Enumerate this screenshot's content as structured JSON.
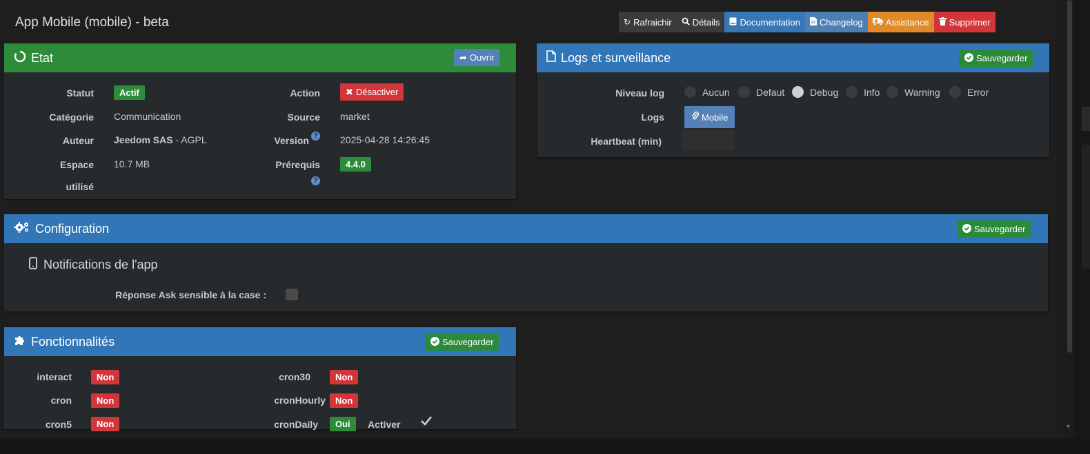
{
  "app": {
    "title": "App Mobile (mobile) - beta"
  },
  "toolbar": {
    "refresh": {
      "label": "Rafraichir",
      "icon": "refresh-icon"
    },
    "details": {
      "label": "Détails",
      "icon": "search-icon"
    },
    "documentation": {
      "label": "Documentation",
      "icon": "book-icon"
    },
    "changelog": {
      "label": "Changelog",
      "icon": "file-icon"
    },
    "assistance": {
      "label": "Assistance",
      "icon": "ambulance-icon"
    },
    "delete": {
      "label": "Supprimer",
      "icon": "trash-icon"
    }
  },
  "etat": {
    "title": "Etat",
    "open_button": "Ouvrir",
    "status_label": "Statut",
    "status_value": "Actif",
    "action_label": "Action",
    "action_button": "Désactiver",
    "category_label": "Catégorie",
    "category_value": "Communication",
    "source_label": "Source",
    "source_value": "market",
    "author_label": "Auteur",
    "author_value": "Jeedom SAS",
    "license_value": " - AGPL",
    "version_label": "Version",
    "version_value": "2025-04-28 14:26:45",
    "space_label_1": "Espace",
    "space_label_2": "utilisé",
    "space_value": "10.7 MB",
    "prereq_label": "Prérequis",
    "prereq_value": "4.4.0"
  },
  "logs": {
    "title": "Logs et surveillance",
    "save_button": "Sauvegarder",
    "level_label": "Niveau log",
    "levels": [
      {
        "label": "Aucun",
        "selected": false
      },
      {
        "label": "Defaut",
        "selected": false
      },
      {
        "label": "Debug",
        "selected": true
      },
      {
        "label": "Info",
        "selected": false
      },
      {
        "label": "Warning",
        "selected": false
      },
      {
        "label": "Error",
        "selected": false
      }
    ],
    "logs_label": "Logs",
    "logs_button": "Mobile",
    "heartbeat_label": "Heartbeat (min)",
    "heartbeat_value": ""
  },
  "configuration": {
    "title": "Configuration",
    "save_button": "Sauvegarder",
    "section_title": "Notifications de l'app",
    "ask_label": "Réponse Ask sensible à la case :",
    "ask_checked": false
  },
  "features": {
    "title": "Fonctionnalités",
    "save_button": "Sauvegarder",
    "items": [
      {
        "name": "interact",
        "value": "Non"
      },
      {
        "name": "cron",
        "value": "Non"
      },
      {
        "name": "cron5",
        "value": "Non"
      },
      {
        "name": "cron30",
        "value": "Non"
      },
      {
        "name": "cronHourly",
        "value": "Non"
      },
      {
        "name": "cronDaily",
        "value": "Oui"
      }
    ],
    "activate_label": "Activer",
    "activate_checked": true
  },
  "colors": {
    "green": "#2e8b3a",
    "blue": "#3276b7",
    "red": "#d2363a",
    "orange": "#e08a2a",
    "panel_bg": "#262a2d",
    "page_bg": "#1e1e1e"
  }
}
